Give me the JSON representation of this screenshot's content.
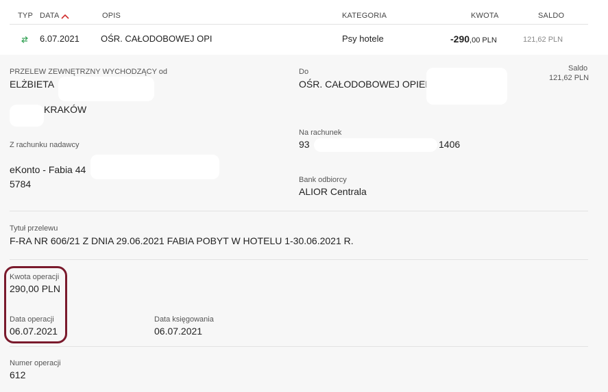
{
  "header": {
    "typ": "TYP",
    "data": "DATA",
    "opis": "OPIS",
    "kategoria": "KATEGORIA",
    "kwota": "KWOTA",
    "saldo": "SALDO"
  },
  "transaction": {
    "date": "6.07.2021",
    "description": "OŚR. CAŁODOBOWEJ OPIEKI",
    "category": "Psy hotele",
    "amount_main": "-290",
    "amount_rest": ",00 PLN",
    "balance": "121,62 PLN"
  },
  "details": {
    "transfer_type": "PRZELEW ZEWNĘTRZNY WYCHODZĄCY od",
    "sender_name": "ELŻBIETA",
    "sender_city": "KRAKÓW",
    "to_label": "Do",
    "recipient_name": "OŚR. CAŁODOBOWEJ OPIEKI",
    "saldo_label": "Saldo",
    "saldo_value": "121,62 PLN",
    "to_account_label": "Na rachunek",
    "to_account_start": "93",
    "to_account_end": "1406",
    "from_account_label": "Z rachunku nadawcy",
    "from_account_name": "eKonto - Fabia 44",
    "from_account_number": "5784",
    "bank_label": "Bank odbiorcy",
    "bank_value": "ALIOR Centrala",
    "title_label": "Tytuł przelewu",
    "title_value": "F-RA NR 606/21 Z DNIA 29.06.2021 FABIA POBYT W HOTELU 1-30.06.2021 R.",
    "op_amount_label": "Kwota operacji",
    "op_amount_value": "290,00 PLN",
    "op_date_label": "Data operacji",
    "op_date_value": "06.07.2021",
    "booking_date_label": "Data księgowania",
    "booking_date_value": "06.07.2021",
    "op_number_label": "Numer operacji",
    "op_number_value": "612"
  },
  "colors": {
    "sort_arrow": "#d12c2c",
    "transfer_icon": "#3aa55a",
    "highlight_border": "#7a1a2c"
  },
  "icons": {
    "sort": "sort-ascending-icon",
    "type": "transfer-arrows-icon"
  }
}
